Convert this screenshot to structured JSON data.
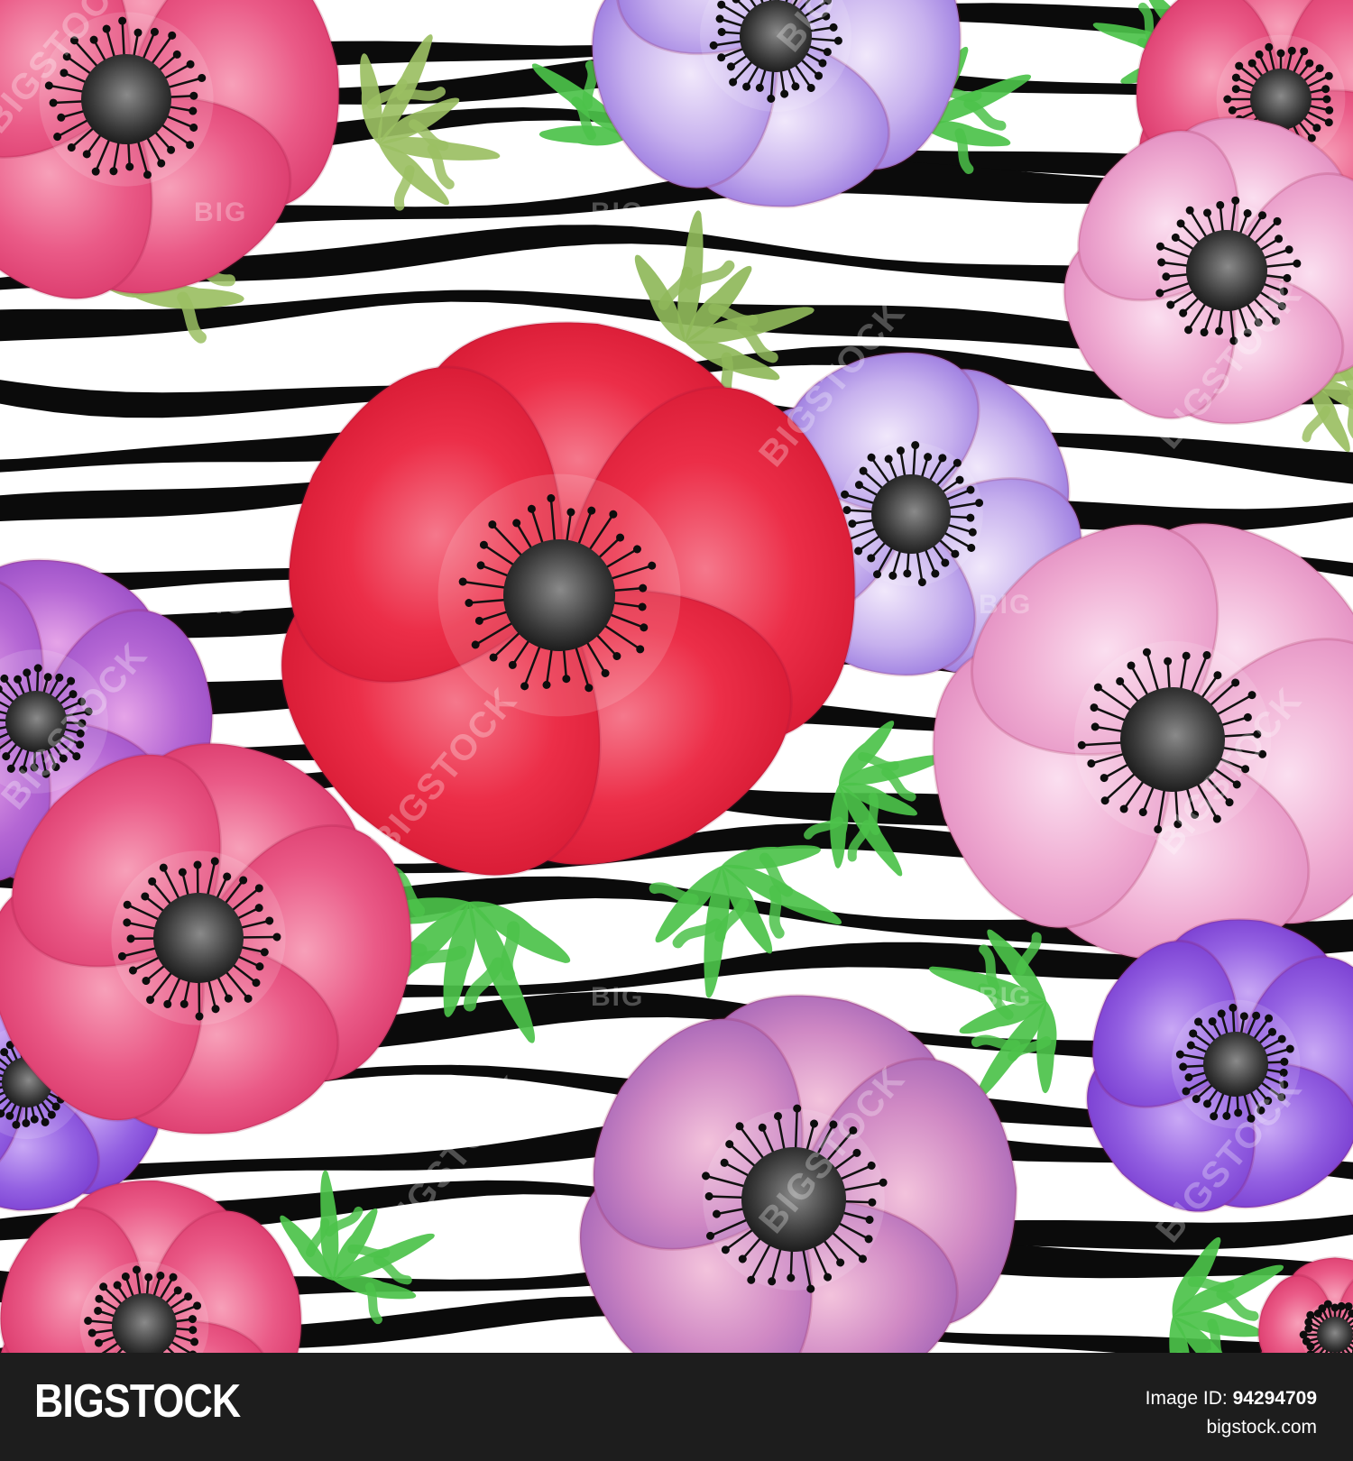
{
  "image": {
    "subject": "Watercolor anemone flowers over a black and white zebra stripe pattern",
    "colors": {
      "stripe": "#0b0b0b",
      "background": "#ffffff",
      "red_flower": "#e8243d",
      "pink_flower": "#e85a86",
      "light_pink_flower": "#f0a6c8",
      "violet_flower": "#b491e4",
      "purple_flower": "#8a52d8",
      "leaf_green": "#4cc24a",
      "leaf_olive": "#9bbf63"
    },
    "watermarks": [
      "BIGSTOCK",
      "BIG"
    ]
  },
  "footer": {
    "logo": "BIGSTOCK",
    "image_id_label": "Image ID:",
    "image_id": "94294709",
    "site": "bigstock.com",
    "background_color": "#1d1d1d"
  }
}
